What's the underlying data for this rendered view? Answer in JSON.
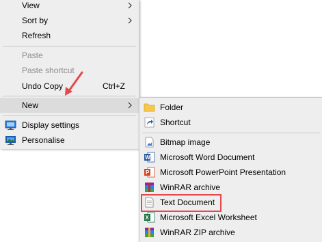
{
  "main_menu": {
    "view_label": "View",
    "sort_by_label": "Sort by",
    "refresh_label": "Refresh",
    "paste_label": "Paste",
    "paste_shortcut_label": "Paste shortcut",
    "undo_copy_label": "Undo Copy",
    "undo_copy_shortcut": "Ctrl+Z",
    "new_label": "New",
    "display_settings_label": "Display settings",
    "personalise_label": "Personalise"
  },
  "new_submenu": {
    "folder_label": "Folder",
    "shortcut_label": "Shortcut",
    "bitmap_label": "Bitmap image",
    "word_label": "Microsoft Word Document",
    "powerpoint_label": "Microsoft PowerPoint Presentation",
    "winrar_label": "WinRAR archive",
    "text_document_label": "Text Document",
    "excel_label": "Microsoft Excel Worksheet",
    "winrar_zip_label": "WinRAR ZIP archive"
  },
  "colors": {
    "menu_bg": "#eeeeee",
    "hover_bg": "#dcdcdc",
    "disabled_text": "#8c8c8c",
    "annotation_red": "#e5484d"
  }
}
